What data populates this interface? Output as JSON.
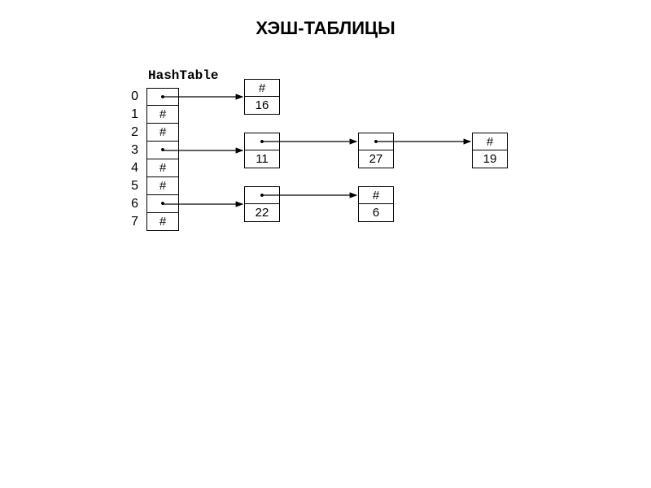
{
  "title": "ХЭШ-ТАБЛИЦЫ",
  "label": "HashTable",
  "indices": [
    "0",
    "1",
    "2",
    "3",
    "4",
    "5",
    "6",
    "7"
  ],
  "table_cells": [
    "•",
    "#",
    "#",
    "•",
    "#",
    "#",
    "•",
    "#"
  ],
  "chains": {
    "row0": [
      {
        "top": "#",
        "bot": "16"
      }
    ],
    "row3": [
      {
        "top": "•",
        "bot": "11"
      },
      {
        "top": "•",
        "bot": "27"
      },
      {
        "top": "#",
        "bot": "19"
      }
    ],
    "row6": [
      {
        "top": "•",
        "bot": "22"
      },
      {
        "top": "#",
        "bot": "6"
      }
    ]
  },
  "chart_data": {
    "type": "table",
    "description": "Hash table with chaining (separate chaining linked lists)",
    "table_size": 8,
    "buckets": [
      {
        "index": 0,
        "chain": [
          16
        ]
      },
      {
        "index": 1,
        "chain": []
      },
      {
        "index": 2,
        "chain": []
      },
      {
        "index": 3,
        "chain": [
          11,
          27,
          19
        ]
      },
      {
        "index": 4,
        "chain": []
      },
      {
        "index": 5,
        "chain": []
      },
      {
        "index": 6,
        "chain": [
          22,
          6
        ]
      },
      {
        "index": 7,
        "chain": []
      }
    ],
    "null_marker": "#",
    "pointer_marker": "•"
  }
}
